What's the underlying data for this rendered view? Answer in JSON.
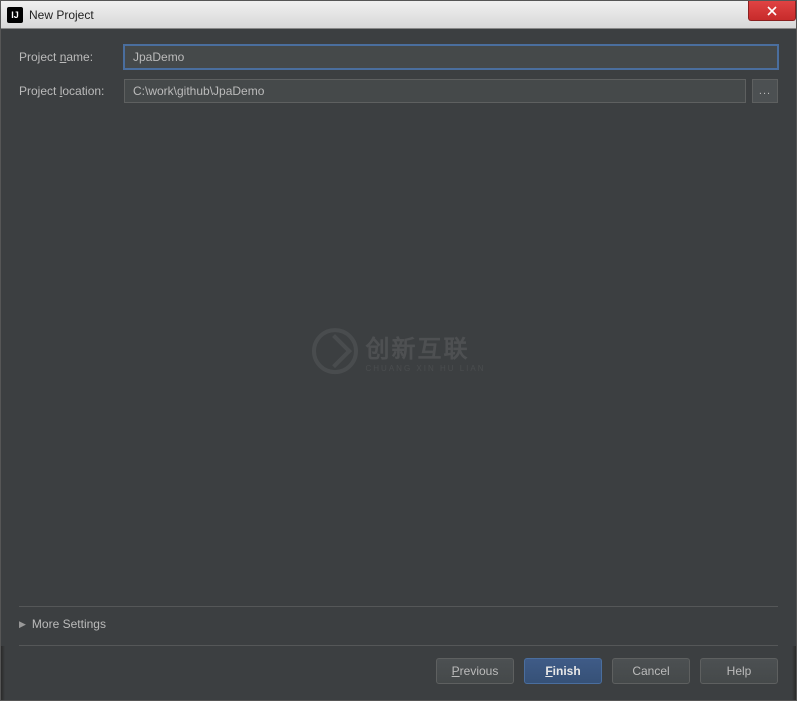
{
  "window": {
    "title": "New Project"
  },
  "form": {
    "name_label_prefix": "Project ",
    "name_label_key": "n",
    "name_label_suffix": "ame:",
    "name_value": "JpaDemo",
    "location_label_prefix": "Project ",
    "location_label_key": "l",
    "location_label_suffix": "ocation:",
    "location_value": "C:\\work\\github\\JpaDemo",
    "browse_label": "..."
  },
  "expander": {
    "label": "More Settings"
  },
  "buttons": {
    "previous_key": "P",
    "previous_rest": "revious",
    "finish_key": "F",
    "finish_rest": "inish",
    "cancel": "Cancel",
    "help": "Help"
  },
  "watermark": {
    "main": "创新互联",
    "sub": "CHUANG XIN HU LIAN"
  }
}
